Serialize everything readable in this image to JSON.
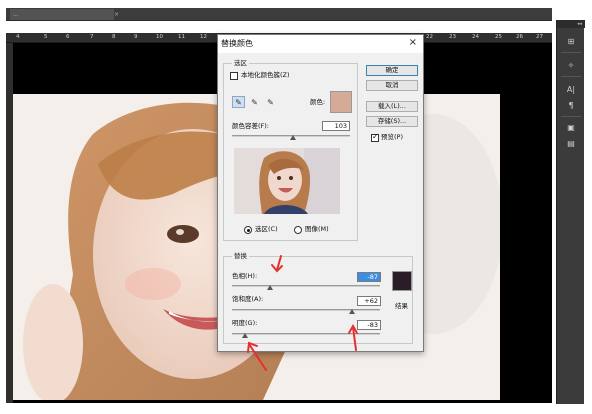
{
  "workspace": {
    "tab_label": "...",
    "tab_close": "×",
    "ruler_numbers": [
      "4",
      "5",
      "6",
      "7",
      "8",
      "9",
      "10",
      "11",
      "12",
      "22",
      "23",
      "24",
      "25",
      "26",
      "27"
    ],
    "right_panel_top": "◂◂",
    "right_panel_icons": [
      "layers-icon",
      "brush-settings-icon",
      "character-icon",
      "paragraph-icon",
      "adjustments-icon",
      "info-icon"
    ],
    "right_panel_glyphs": [
      "⊞",
      "✧",
      "A|",
      "¶",
      "▣",
      "▤"
    ]
  },
  "dialog": {
    "title": "替换颜色",
    "close": "×",
    "selection": {
      "group_label": "选区",
      "localized_label": "本地化颜色簇(Z)",
      "localized_checked": false,
      "color_label": "颜色:",
      "color_hex": "#d4ab96",
      "fuzziness_label": "颜色容差(F):",
      "fuzziness_value": "103",
      "fuzziness_percent": 0.52,
      "radio_selection": "选区(C)",
      "radio_image": "图像(M)",
      "selected_radio": "selection"
    },
    "buttons": {
      "ok": "确定",
      "cancel": "取消",
      "load": "载入(L)...",
      "save": "存储(S)...",
      "preview_label": "预览(P)",
      "preview_checked": true
    },
    "replace": {
      "group_label": "替换",
      "hue_label": "色相(H):",
      "hue_value": "-87",
      "hue_fraction": 0.26,
      "saturation_label": "饱和度(A):",
      "saturation_value": "+62",
      "saturation_fraction": 0.81,
      "lightness_label": "明度(G):",
      "lightness_value": "-83",
      "lightness_fraction": 0.09,
      "result_label": "结果",
      "result_hex": "#2b1c2a"
    }
  },
  "colors": {
    "annotation_arrow": "#e5302f",
    "selection_highlight": "#3d8ee0",
    "dialog_bg": "#f0f0f0"
  }
}
